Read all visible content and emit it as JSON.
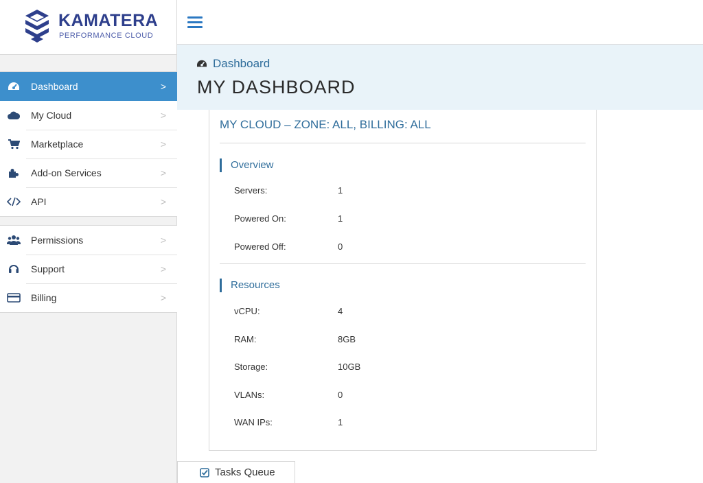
{
  "brand": {
    "name": "KAMATERA",
    "tagline": "PERFORMANCE CLOUD"
  },
  "sidebar": {
    "primary": [
      {
        "label": "Dashboard",
        "icon": "dashboard-gauge-icon",
        "active": true
      },
      {
        "label": "My Cloud",
        "icon": "cloud-icon"
      },
      {
        "label": "Marketplace",
        "icon": "cart-icon"
      },
      {
        "label": "Add-on Services",
        "icon": "puzzle-icon"
      },
      {
        "label": "API",
        "icon": "code-icon"
      }
    ],
    "secondary": [
      {
        "label": "Permissions",
        "icon": "users-icon"
      },
      {
        "label": "Support",
        "icon": "headset-icon"
      },
      {
        "label": "Billing",
        "icon": "credit-card-icon"
      }
    ],
    "chevron": ">"
  },
  "header": {
    "breadcrumb": "Dashboard",
    "title": "MY DASHBOARD"
  },
  "card": {
    "title": "MY CLOUD – ZONE: ALL, BILLING: ALL",
    "overview": {
      "title": "Overview",
      "rows": [
        {
          "label": "Servers:",
          "value": "1"
        },
        {
          "label": "Powered On:",
          "value": "1"
        },
        {
          "label": "Powered Off:",
          "value": "0"
        }
      ]
    },
    "resources": {
      "title": "Resources",
      "rows": [
        {
          "label": "vCPU:",
          "value": "4"
        },
        {
          "label": "RAM:",
          "value": "8GB"
        },
        {
          "label": "Storage:",
          "value": "10GB"
        },
        {
          "label": "VLANs:",
          "value": "0"
        },
        {
          "label": "WAN IPs:",
          "value": "1"
        }
      ]
    }
  },
  "tasks": {
    "label": "Tasks Queue"
  },
  "colors": {
    "accent": "#3d8fcc",
    "brand": "#2e3f8c",
    "link": "#2f6d9b",
    "header_band": "#e9f3f9"
  }
}
